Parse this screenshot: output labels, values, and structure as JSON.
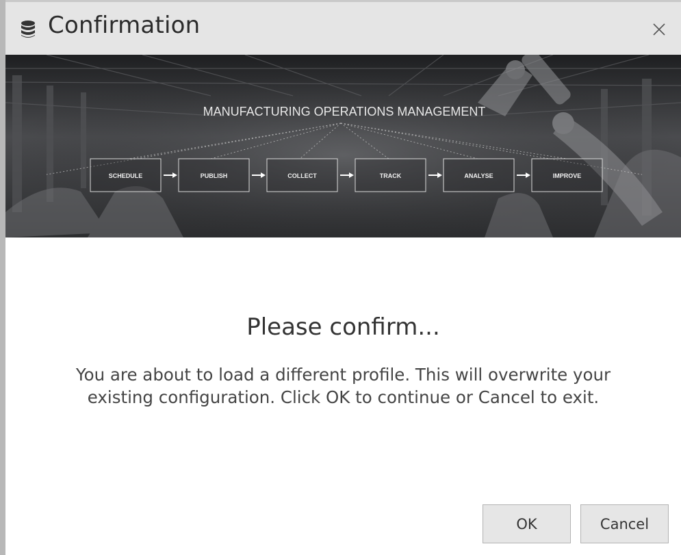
{
  "window": {
    "title": "Confirmation",
    "title_icon": "database-icon",
    "close_icon": "close-icon"
  },
  "banner": {
    "title": "MANUFACTURING OPERATIONS MANAGEMENT",
    "steps": [
      "SCHEDULE",
      "PUBLISH",
      "COLLECT",
      "TRACK",
      "ANALYSE",
      "IMPROVE"
    ],
    "arrow_icon": "arrow-right-icon"
  },
  "dialog": {
    "heading": "Please confirm...",
    "message": "You are about to load a different profile. This will overwrite your existing configuration. Click OK to continue or Cancel to exit."
  },
  "buttons": {
    "ok_label": "OK",
    "cancel_label": "Cancel"
  },
  "colors": {
    "titlebar_bg": "#e5e5e5",
    "button_bg": "#e6e6e6",
    "banner_bg": "#3a3b3d"
  }
}
